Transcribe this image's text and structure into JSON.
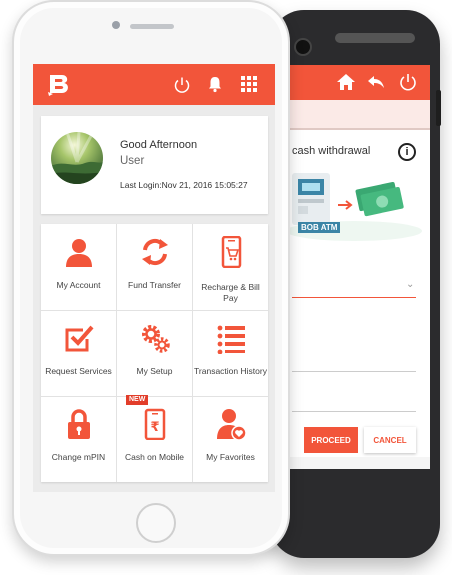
{
  "colors": {
    "brand": "#f2553a",
    "background": "#ffffff"
  },
  "back_phone": {
    "title": "cash withdrawal",
    "info_label": "i",
    "atm_label": "BOB ATM",
    "proceed_label": "PROCEED",
    "cancel_label": "CANCEL",
    "icons": [
      "home-icon",
      "back-arrow-icon",
      "power-icon"
    ]
  },
  "front_phone": {
    "app_bar": {
      "icons": [
        "bob-logo",
        "power-icon",
        "bell-icon",
        "grid-icon"
      ]
    },
    "profile": {
      "greeting": "Good Afternoon",
      "name": "User",
      "last_login": "Last Login:Nov 21, 2016 15:05:27"
    },
    "menu": [
      {
        "label": "My Account",
        "icon": "person-icon"
      },
      {
        "label": "Fund Transfer",
        "icon": "transfer-arrows-icon"
      },
      {
        "label": "Recharge & Bill Pay",
        "icon": "mobile-cart-icon"
      },
      {
        "label": "Request Services",
        "icon": "checkbox-icon"
      },
      {
        "label": "My Setup",
        "icon": "gears-icon"
      },
      {
        "label": "Transaction History",
        "icon": "list-icon"
      },
      {
        "label": "Change mPIN",
        "icon": "lock-icon"
      },
      {
        "label": "Cash on Mobile",
        "icon": "rupee-mobile-icon"
      },
      {
        "label": "My Favorites",
        "icon": "person-heart-icon"
      }
    ],
    "new_badge": "NEW"
  }
}
